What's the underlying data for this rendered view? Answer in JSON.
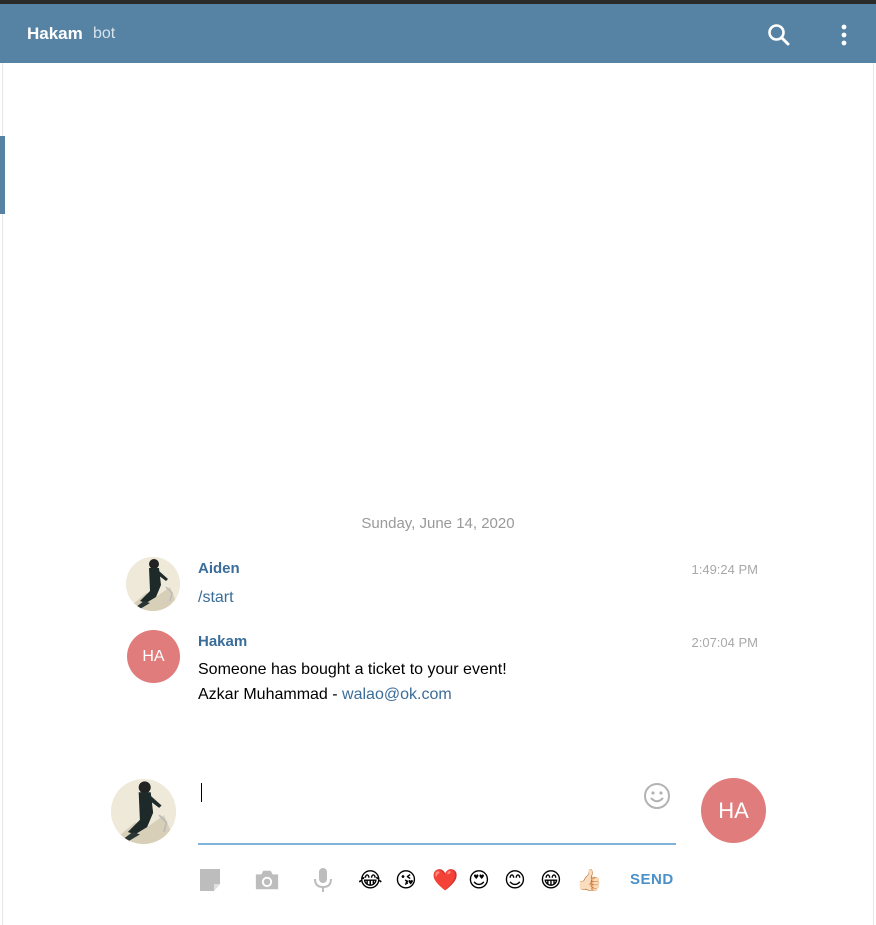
{
  "header": {
    "title": "Hakam",
    "subtitle": "bot",
    "search_icon": "search-icon",
    "menu_icon": "more-vertical-icon"
  },
  "colors": {
    "header_bg": "#5682a3",
    "accent": "#3a6d99",
    "avatar_bg": "#e07c7c",
    "input_underline": "#7fb3d9",
    "send": "#4a90c9"
  },
  "chat": {
    "date": "Sunday, June 14, 2020",
    "messages": [
      {
        "author": "Aiden",
        "time": "1:49:24 PM",
        "text": "/start",
        "avatar": "user-photo"
      },
      {
        "author": "Hakam",
        "time": "2:07:04 PM",
        "avatar_initials": "HA",
        "text_line1": "Someone has bought a ticket to your event!",
        "text_line2_prefix": "Azkar Muhammad - ",
        "text_line2_link": "walao@ok.com"
      }
    ]
  },
  "composer": {
    "input_value": "",
    "my_initials": "HA",
    "emoji_picker_icon": "smiley-icon",
    "tools": [
      "document-icon",
      "camera-icon",
      "microphone-icon"
    ],
    "quick_emojis": [
      "😂",
      "😘",
      "❤️",
      "😍",
      "😊",
      "😁",
      "👍🏻"
    ],
    "send_label": "SEND"
  }
}
